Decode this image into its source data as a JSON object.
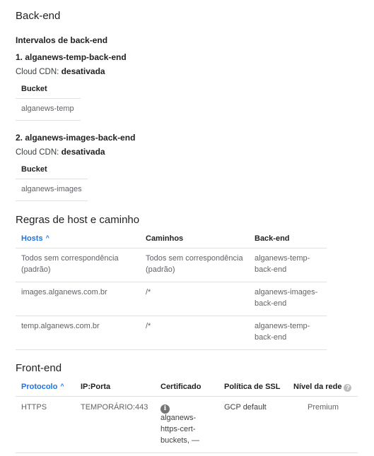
{
  "backend": {
    "title": "Back-end",
    "intervals_title": "Intervalos de back-end",
    "cdn_label": "Cloud CDN:",
    "items": [
      {
        "name": "1. alganews-temp-back-end",
        "cdn_value": "desativada",
        "bucket_header": "Bucket",
        "bucket": "alganews-temp"
      },
      {
        "name": "2. alganews-images-back-end",
        "cdn_value": "desativada",
        "bucket_header": "Bucket",
        "bucket": "alganews-images"
      }
    ]
  },
  "host_rules": {
    "title": "Regras de host e caminho",
    "headers": {
      "hosts": "Hosts",
      "paths": "Caminhos",
      "backend": "Back-end"
    },
    "rows": [
      {
        "host": "Todos sem correspondência (padrão)",
        "path": "Todos sem correspondência (padrão)",
        "backend": "alganews-temp-back-end"
      },
      {
        "host": "images.alganews.com.br",
        "path": "/*",
        "backend": "alganews-images-back-end"
      },
      {
        "host": "temp.alganews.com.br",
        "path": "/*",
        "backend": "alganews-temp-back-end"
      }
    ]
  },
  "frontend": {
    "title": "Front-end",
    "headers": {
      "protocol": "Protocolo",
      "ipport": "IP:Porta",
      "cert": "Certificado",
      "ssl": "Política de SSL",
      "tier": "Nível da rede"
    },
    "rows": [
      {
        "protocol": "HTTPS",
        "ipport": "TEMPORÁRIO:443",
        "cert": "alganews-https-cert-buckets, —",
        "ssl": "GCP default",
        "tier": "Premium"
      }
    ]
  },
  "icons": {
    "sort": "arrow-up-icon",
    "help": "help-icon",
    "info": "info-icon"
  },
  "colors": {
    "link": "#1a73e8",
    "divider": "#e0e0e0",
    "muted": "#5f6368"
  }
}
